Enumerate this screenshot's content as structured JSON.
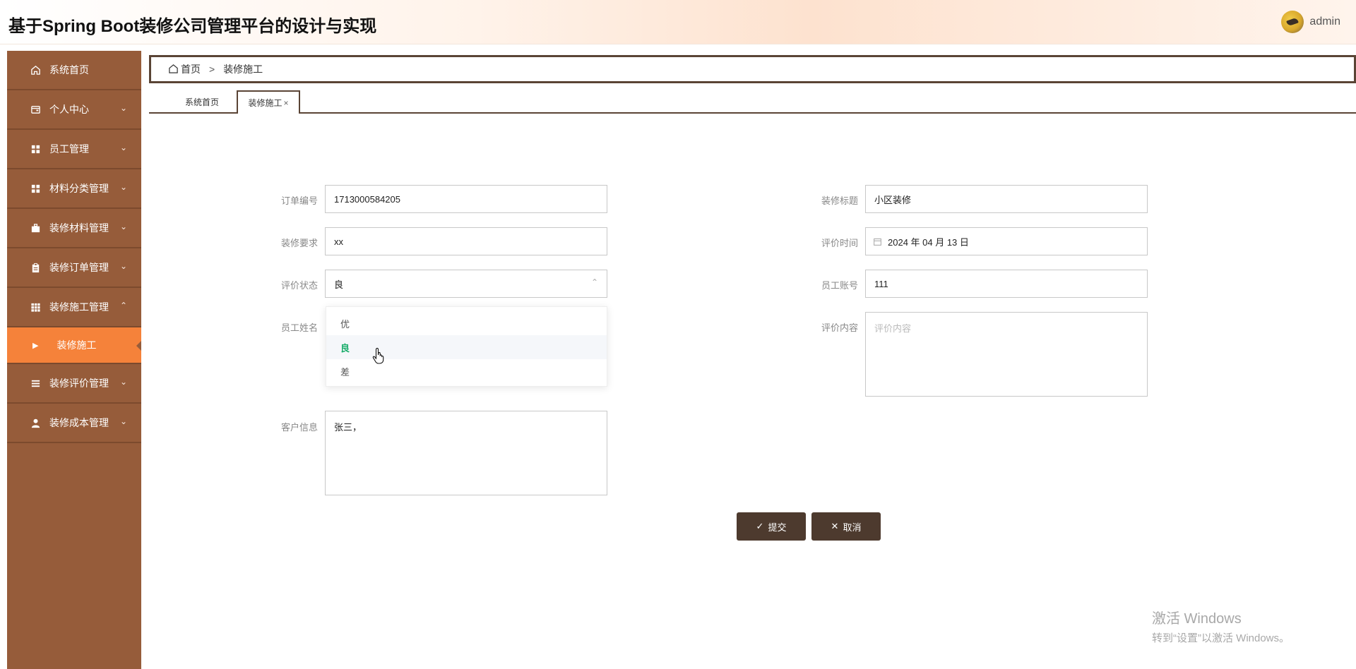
{
  "header": {
    "title": "基于Spring Boot装修公司管理平台的设计与实现",
    "user": "admin"
  },
  "sidebar": {
    "items": [
      {
        "label": "系统首页",
        "icon": "home-icon",
        "has_chevron": false
      },
      {
        "label": "个人中心",
        "icon": "wallet-icon",
        "chevron": "⌄"
      },
      {
        "label": "员工管理",
        "icon": "grid-icon",
        "chevron": "⌄"
      },
      {
        "label": "材料分类管理",
        "icon": "grid-icon",
        "chevron": "⌄"
      },
      {
        "label": "装修材料管理",
        "icon": "briefcase-icon",
        "chevron": "⌄"
      },
      {
        "label": "装修订单管理",
        "icon": "clipboard-icon",
        "chevron": "⌄"
      },
      {
        "label": "装修施工管理",
        "icon": "table-icon",
        "chevron": "⌃"
      }
    ],
    "active_sub": "装修施工",
    "items_after": [
      {
        "label": "装修评价管理",
        "icon": "list-icon",
        "chevron": "⌄"
      },
      {
        "label": "装修成本管理",
        "icon": "user-icon",
        "chevron": "⌄"
      }
    ]
  },
  "breadcrumb": {
    "home": "首页",
    "separator": ">",
    "current": "装修施工"
  },
  "tabs": [
    {
      "label": "系统首页"
    },
    {
      "label": "装修施工",
      "close": "×"
    }
  ],
  "form": {
    "order_no": {
      "label": "订单编号",
      "value": "1713000584205"
    },
    "title": {
      "label": "装修标题",
      "value": "小区装修"
    },
    "requirement": {
      "label": "装修要求",
      "value": "xx"
    },
    "eval_time": {
      "label": "评价时间",
      "value": "2024 年 04 月 13 日"
    },
    "eval_status": {
      "label": "评价状态",
      "value": "良"
    },
    "emp_account": {
      "label": "员工账号",
      "value": "111"
    },
    "emp_name": {
      "label": "员工姓名"
    },
    "eval_content": {
      "label": "评价内容",
      "placeholder": "评价内容"
    },
    "customer_info": {
      "label": "客户信息",
      "value": "张三，"
    }
  },
  "dropdown": {
    "options": [
      "优",
      "良",
      "差"
    ],
    "selected": "良"
  },
  "buttons": {
    "submit": "提交",
    "cancel": "取消"
  },
  "watermark": {
    "line1": "激活 Windows",
    "line2": "转到“设置”以激活 Windows。"
  },
  "colors": {
    "sidebar": "#965c3a",
    "active": "#f5823a",
    "button": "#4d3a2e",
    "selected_option": "#1aad6b"
  }
}
